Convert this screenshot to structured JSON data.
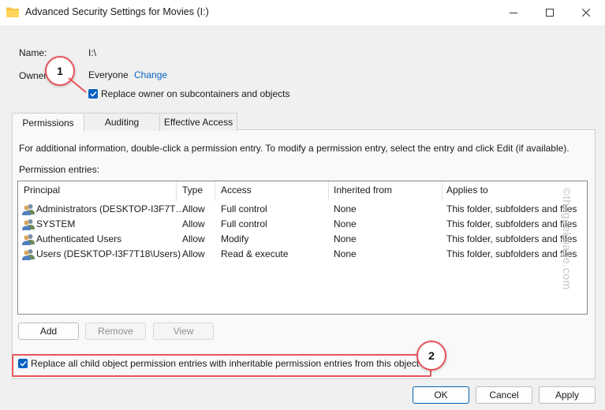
{
  "window": {
    "title": "Advanced Security Settings for Movies (I:)",
    "controls": [
      "minimize-icon",
      "maximize-icon",
      "close-icon"
    ]
  },
  "name": {
    "label": "Name:",
    "value": "I:\\"
  },
  "owner": {
    "label": "Owner:",
    "value": "Everyone",
    "change_link": "Change"
  },
  "replace_owner": {
    "label": "Replace owner on subcontainers and objects",
    "checked": true
  },
  "tabs": [
    {
      "label": "Permissions",
      "active": true
    },
    {
      "label": "Auditing",
      "active": false
    },
    {
      "label": "Effective Access",
      "active": false
    }
  ],
  "info_text": "For additional information, double-click a permission entry. To modify a permission entry, select the entry and click Edit (if available).",
  "entries_label": "Permission entries:",
  "table": {
    "columns": [
      "Principal",
      "Type",
      "Access",
      "Inherited from",
      "Applies to"
    ],
    "rows": [
      [
        "Administrators (DESKTOP-I3F7T…",
        "Allow",
        "Full control",
        "None",
        "This folder, subfolders and files"
      ],
      [
        "SYSTEM",
        "Allow",
        "Full control",
        "None",
        "This folder, subfolders and files"
      ],
      [
        "Authenticated Users",
        "Allow",
        "Modify",
        "None",
        "This folder, subfolders and files"
      ],
      [
        "Users (DESKTOP-I3F7T18\\Users)",
        "Allow",
        "Read & execute",
        "None",
        "This folder, subfolders and files"
      ]
    ]
  },
  "list_buttons": {
    "add": "Add",
    "remove": "Remove",
    "view": "View"
  },
  "replace_child": {
    "label": "Replace all child object permission entries with inheritable permission entries from this object",
    "checked": true
  },
  "footer": {
    "ok": "OK",
    "cancel": "Cancel",
    "apply": "Apply"
  },
  "badges": {
    "one": "1",
    "two": "2"
  },
  "watermark": "©thegeekpage.com",
  "colors": {
    "accent": "#0060c0",
    "highlight": "#e8545a",
    "link": "#0a66c2"
  }
}
